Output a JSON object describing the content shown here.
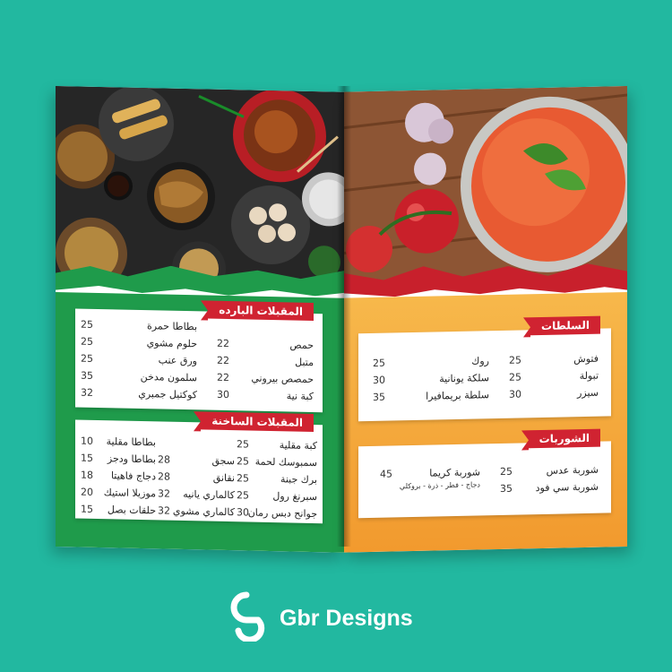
{
  "cold_appetizers": {
    "title": "المقبلات البارده",
    "col1": [
      {
        "name": "حمص",
        "price": "22"
      },
      {
        "name": "متبل",
        "price": "22"
      },
      {
        "name": "حمصص بيروني",
        "price": "22"
      },
      {
        "name": "كبة نية",
        "price": "30"
      }
    ],
    "col2": [
      {
        "name": "بطاطا حمرة",
        "price": "25"
      },
      {
        "name": "حلوم مشوي",
        "price": "25"
      },
      {
        "name": "ورق عنب",
        "price": "25"
      },
      {
        "name": "سلمون مدخن",
        "price": "35"
      },
      {
        "name": "كوكتيل جمبري",
        "price": "32"
      }
    ]
  },
  "hot_appetizers": {
    "title": "المقبلات الساخنة",
    "col1": [
      {
        "name": "كبة مقلية",
        "price": "25"
      },
      {
        "name": "سمبوسك لحمة",
        "price": "25"
      },
      {
        "name": "برك جبنة",
        "price": "25"
      },
      {
        "name": "سبرنغ رول",
        "price": "25"
      },
      {
        "name": "جوانح دبس رمان",
        "price": "30"
      }
    ],
    "col2": [
      {
        "name": "",
        "price": ""
      },
      {
        "name": "سجق",
        "price": "28"
      },
      {
        "name": "نقانق",
        "price": "28"
      },
      {
        "name": "كالماري يانيه",
        "price": "32"
      },
      {
        "name": "كالماري مشوي",
        "price": "32"
      }
    ],
    "col3": [
      {
        "name": "بطاطا مقلية",
        "price": "10"
      },
      {
        "name": "بطاطا ودجز",
        "price": "15"
      },
      {
        "name": "دجاج فاهيتا",
        "price": "18"
      },
      {
        "name": "موزيلا استيك",
        "price": "20"
      },
      {
        "name": "حلقات بصل",
        "price": "15"
      }
    ]
  },
  "salads": {
    "title": "السلطات",
    "col1": [
      {
        "name": "فتوش",
        "price": "25"
      },
      {
        "name": "تبولة",
        "price": "25"
      },
      {
        "name": "سيزر",
        "price": "30"
      }
    ],
    "col2": [
      {
        "name": "روك",
        "price": "25"
      },
      {
        "name": "سلكة يونانية",
        "price": "30"
      },
      {
        "name": "سلطة بريمافيرا",
        "price": "35"
      }
    ]
  },
  "soups": {
    "title": "الشوربات",
    "col1": [
      {
        "name": "شوربة عدس",
        "price": "25"
      },
      {
        "name": "شوربة سي فود",
        "price": "35"
      }
    ],
    "col2": [
      {
        "name": "شوربة كريما",
        "price": "45"
      }
    ],
    "col2_note": "دجاج - فطر - ذرة - بروكلي"
  },
  "brand": {
    "name": "Gbr Designs"
  },
  "colors": {
    "background": "#22b8a0",
    "green": "#1f9b4b",
    "red": "#d02331",
    "orange": "#f29a2e"
  }
}
